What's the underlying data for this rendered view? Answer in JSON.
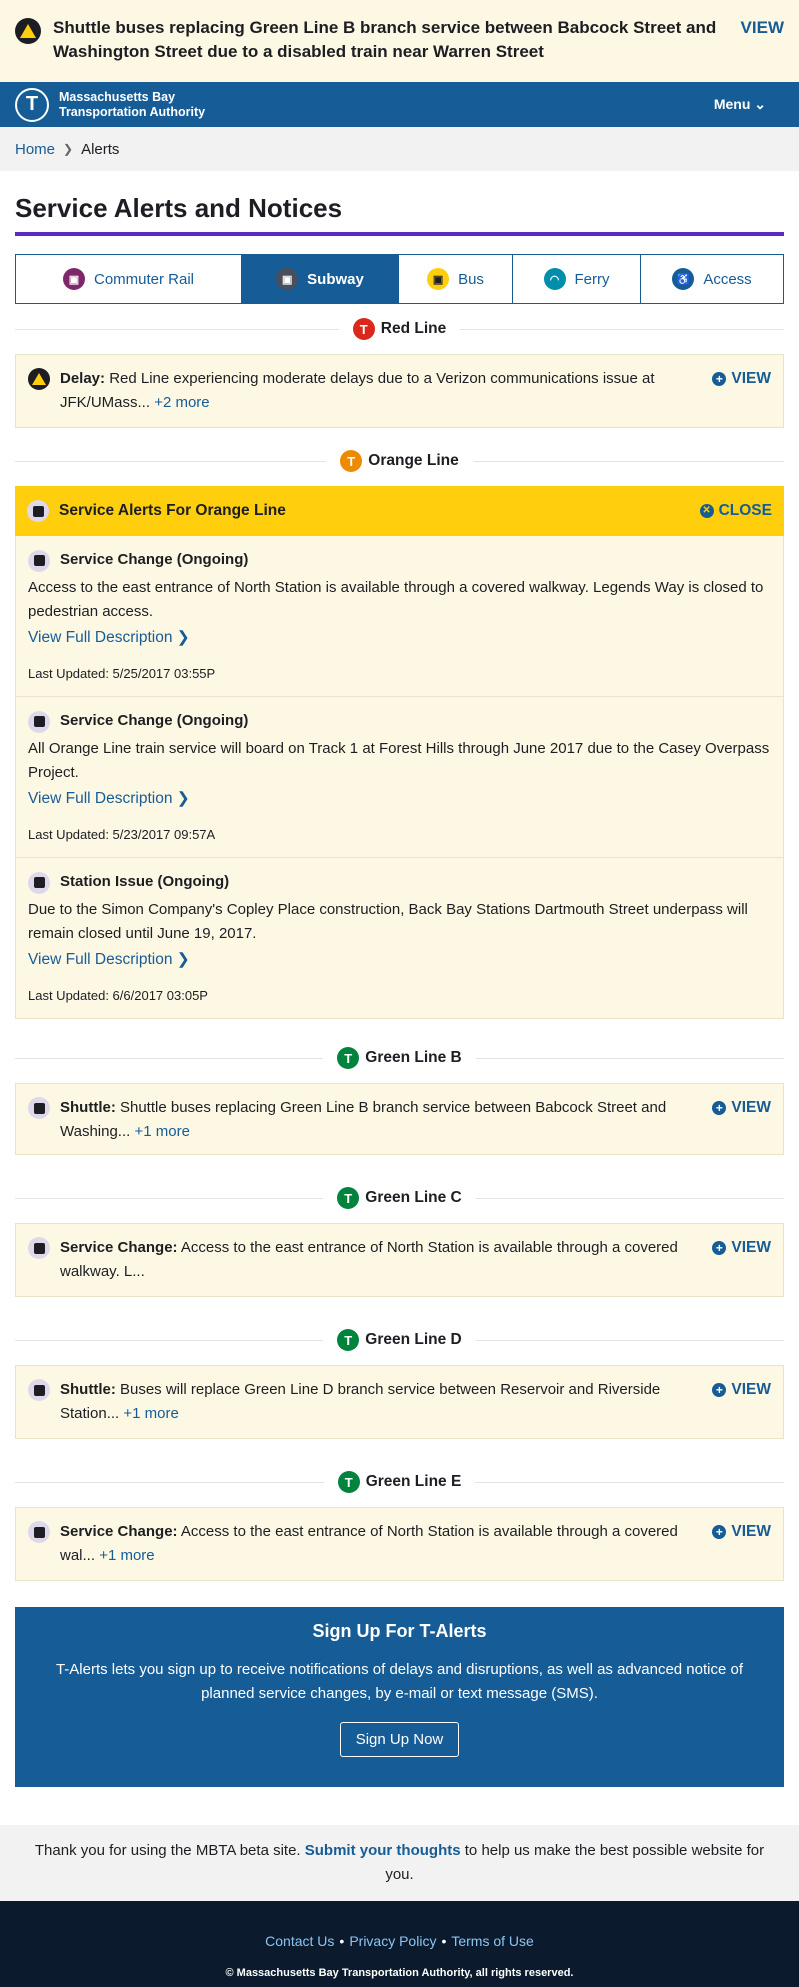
{
  "banner": {
    "text": "Shuttle buses replacing Green Line B branch service between Babcock Street and Washington Street due to a disabled train near Warren Street",
    "view_label": "VIEW"
  },
  "header": {
    "logo_letter": "T",
    "org_line1": "Massachusetts Bay",
    "org_line2": "Transportation Authority",
    "menu_label": "Menu ⌄"
  },
  "breadcrumb": {
    "home": "Home",
    "current": "Alerts"
  },
  "page_title": "Service Alerts and Notices",
  "modes": [
    {
      "label": "Commuter Rail",
      "color": "#80276c"
    },
    {
      "label": "Subway",
      "color": "#494f5c"
    },
    {
      "label": "Bus",
      "color": "#ffce0c"
    },
    {
      "label": "Ferry",
      "color": "#008eaa"
    },
    {
      "label": "Access",
      "color": "#165c96"
    }
  ],
  "red": {
    "name": "Red Line",
    "color": "#da291c",
    "kind": "Delay:",
    "text": " Red Line experiencing moderate delays due to a Verizon communications issue at JFK/UMass... ",
    "more": "+2 more",
    "view": "VIEW"
  },
  "orange": {
    "name": "Orange Line",
    "color": "#ed8b00",
    "expanded_title": "Service Alerts For Orange Line",
    "close_label": "CLOSE",
    "alerts": [
      {
        "title": "Service Change (Ongoing)",
        "desc": "Access to the east entrance of North Station is available through a covered walkway. Legends Way is closed to pedestrian access.",
        "link": "View Full Description ❯",
        "updated": "Last Updated: 5/25/2017 03:55P"
      },
      {
        "title": "Service Change (Ongoing)",
        "desc": "All Orange Line train service will board on Track 1 at Forest Hills through June 2017 due to the Casey Overpass Project.",
        "link": "View Full Description ❯",
        "updated": "Last Updated: 5/23/2017 09:57A"
      },
      {
        "title": "Station Issue (Ongoing)",
        "desc": "Due to the Simon Company's Copley Place construction, Back Bay Stations Dartmouth Street underpass will remain closed until June 19, 2017.",
        "link": "View Full Description ❯",
        "updated": "Last Updated: 6/6/2017 03:05P"
      }
    ]
  },
  "green_color": "#00843d",
  "green_b": {
    "name": "Green Line B",
    "kind": "Shuttle:",
    "text": " Shuttle buses replacing Green Line B branch service between Babcock Street and Washing... ",
    "more": "+1 more",
    "view": "VIEW"
  },
  "green_c": {
    "name": "Green Line C",
    "kind": "Service Change:",
    "text": " Access to the east entrance of North Station is available through a covered walkway. L...",
    "view": "VIEW"
  },
  "green_d": {
    "name": "Green Line D",
    "kind": "Shuttle:",
    "text": " Buses will replace Green Line D branch service between Reservoir and Riverside Station... ",
    "more": "+1 more",
    "view": "VIEW"
  },
  "green_e": {
    "name": "Green Line E",
    "kind": "Service Change:",
    "text": " Access to the east entrance of North Station is available through a covered wal... ",
    "more": "+1 more",
    "view": "VIEW"
  },
  "signup": {
    "title": "Sign Up For T-Alerts",
    "text": "T-Alerts lets you sign up to receive notifications of delays and disruptions, as well as advanced notice of planned service changes, by e-mail or text message (SMS).",
    "button": "Sign Up Now"
  },
  "beta": {
    "before": "Thank you for using the MBTA beta site. ",
    "link": "Submit your thoughts",
    "after": " to help us make the best possible website for you."
  },
  "footer": {
    "contact": "Contact Us",
    "privacy": "Privacy Policy",
    "terms": "Terms of Use",
    "copyright": "© Massachusetts Bay Transportation Authority, all rights reserved."
  }
}
